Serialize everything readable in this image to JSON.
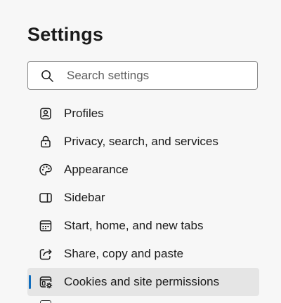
{
  "settings": {
    "title": "Settings",
    "search": {
      "placeholder": "Search settings",
      "value": ""
    },
    "items": [
      {
        "label": "Profiles",
        "icon": "profile-icon",
        "active": false
      },
      {
        "label": "Privacy, search, and services",
        "icon": "lock-icon",
        "active": false
      },
      {
        "label": "Appearance",
        "icon": "palette-icon",
        "active": false
      },
      {
        "label": "Sidebar",
        "icon": "sidebar-icon",
        "active": false
      },
      {
        "label": "Start, home, and new tabs",
        "icon": "home-tabs-icon",
        "active": false
      },
      {
        "label": "Share, copy and paste",
        "icon": "share-icon",
        "active": false
      },
      {
        "label": "Cookies and site permissions",
        "icon": "cookies-permissions-icon",
        "active": true
      }
    ]
  },
  "colors": {
    "background": "#f7f7f7",
    "active_background": "#e5e5e5",
    "accent": "#0f6cbd"
  }
}
